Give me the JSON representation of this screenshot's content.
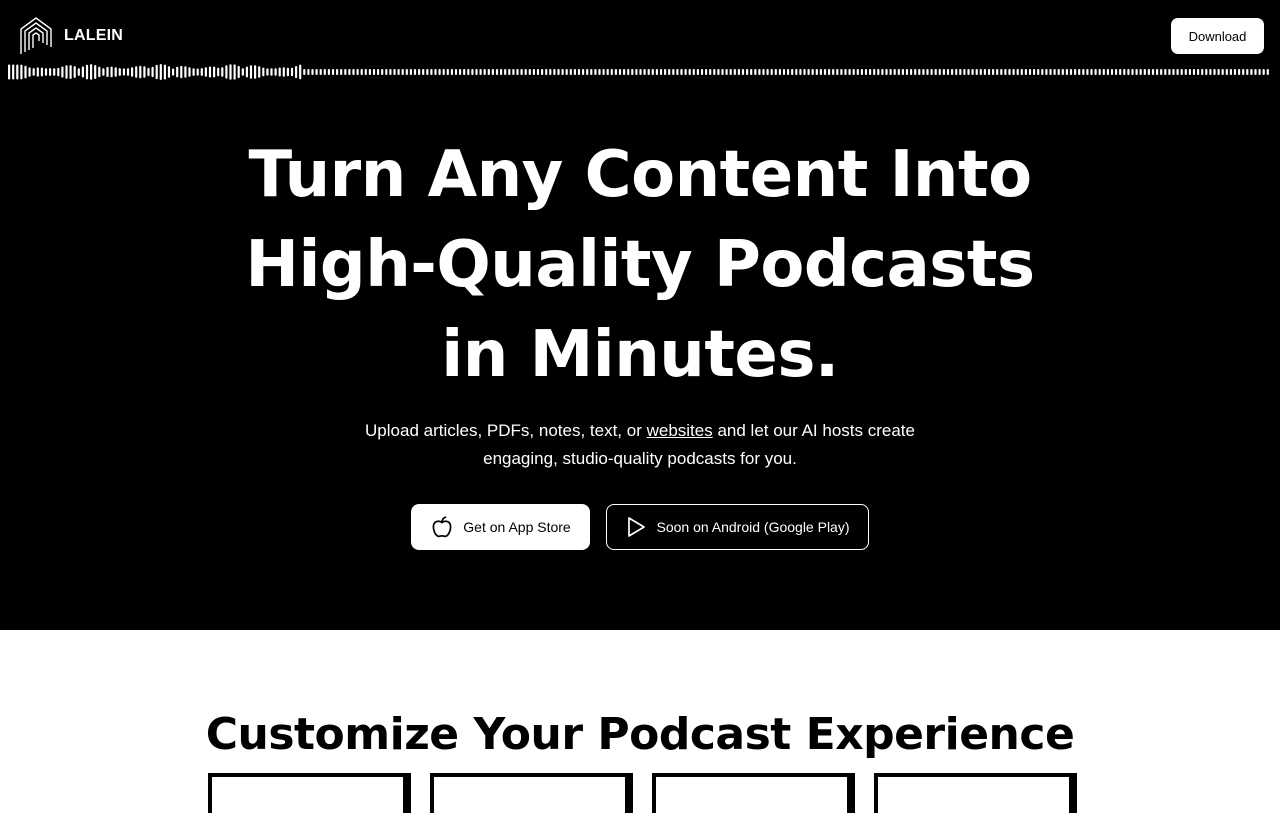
{
  "brand": {
    "name": "LALEIN",
    "logo_icon": "concentric-arch-logo-icon"
  },
  "header": {
    "download_label": "Download"
  },
  "hero": {
    "headline_line1": "Turn Any Content Into",
    "headline_line2": "High-Quality Podcasts",
    "headline_line3": "in Minutes.",
    "sub_before_link": "Upload articles, PDFs, notes, text, or ",
    "sub_link": "websites",
    "sub_after_link": " and let our AI hosts create engaging, studio-quality podcasts for you.",
    "appstore_label": "Get on App Store",
    "appstore_icon": "apple-icon",
    "android_label": "Soon on Android (Google Play)",
    "android_icon": "play-icon"
  },
  "features": {
    "title": "Customize Your Podcast Experience",
    "card_count_visible": 4
  },
  "colors": {
    "hero_background": "#000000",
    "page_background": "#ffffff",
    "text_on_dark": "#ffffff"
  }
}
